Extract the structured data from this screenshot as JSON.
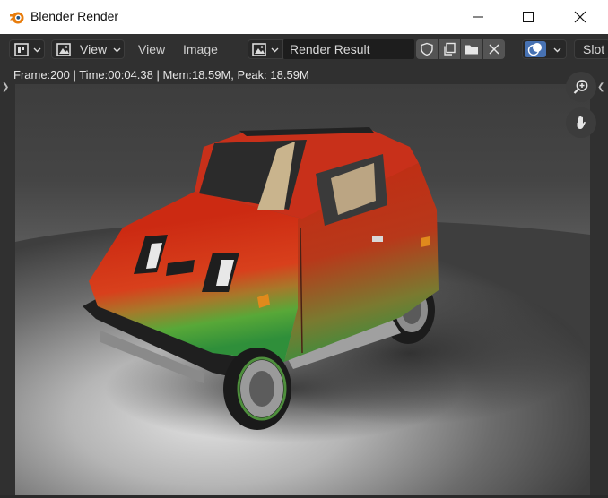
{
  "window": {
    "title": "Blender Render"
  },
  "header": {
    "view_menu_label": "View",
    "menu_items": [
      "View",
      "Image"
    ],
    "image_name": "Render Result",
    "slot_label": "Slot"
  },
  "status": {
    "text": "Frame:200 | Time:00:04.38 | Mem:18.59M, Peak: 18.59M"
  },
  "colors": {
    "accent_blue": "#4772b3",
    "header_bg": "#303030",
    "status_text": "#e6e6e6"
  },
  "icons": [
    "blender-logo-icon",
    "minimize-icon",
    "maximize-icon",
    "close-icon",
    "editor-type-icon",
    "image-icon",
    "shield-icon",
    "duplicate-icon",
    "folder-icon",
    "x-icon",
    "overlay-icon",
    "zoom-icon",
    "hand-icon"
  ]
}
